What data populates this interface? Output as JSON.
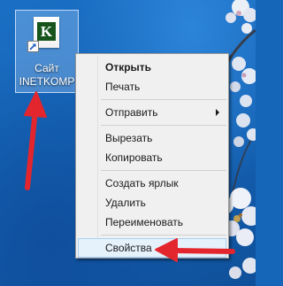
{
  "shortcut": {
    "logo_letter": "K",
    "label_line1": "Сайт",
    "label_line2": "INETKOMP"
  },
  "context_menu": {
    "open": "Открыть",
    "print": "Печать",
    "send_to": "Отправить",
    "cut": "Вырезать",
    "copy": "Копировать",
    "create_shortcut": "Создать ярлык",
    "delete": "Удалить",
    "rename": "Переименовать",
    "properties": "Свойства"
  },
  "colors": {
    "desktop_blue": "#1565b8",
    "menu_background": "#f0f0f0",
    "menu_highlight": "#e5f1fb",
    "annotation_arrow": "#e3262d",
    "logo_green": "#16541c"
  },
  "icons": {
    "shortcut_file": "document-icon",
    "shortcut_overlay": "shortcut-arrow-icon",
    "submenu": "chevron-right-icon"
  }
}
